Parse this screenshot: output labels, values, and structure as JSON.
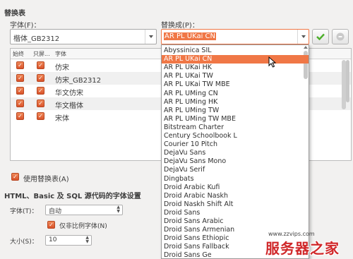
{
  "section_title": "替换表",
  "font_label": "字体(F)：",
  "font_value": "楷体_GB2312",
  "replace_label": "替换成(P)：",
  "replace_value": "AR PL UKai CN",
  "table": {
    "headers": [
      "始终",
      "只屏...",
      "字体"
    ],
    "rows": [
      {
        "font": "仿宋",
        "always": true,
        "screen_only": true
      },
      {
        "font": "仿宋_GB2312",
        "always": true,
        "screen_only": true
      },
      {
        "font": "华文仿宋",
        "always": true,
        "screen_only": true
      },
      {
        "font": "华文楷体",
        "always": true,
        "screen_only": true
      },
      {
        "font": "宋体",
        "always": true,
        "screen_only": true
      }
    ]
  },
  "use_table_label": "使用替换表(A)",
  "html_section_title": "HTML、Basic 及 SQL 源代码的字体设置",
  "src_font_label": "字体(T)：",
  "src_font_value": "自动",
  "proportional_label": "仅非比例字体(N)",
  "size_label": "大小(S)：",
  "size_value": "10",
  "dropdown_items": [
    "Abyssinica SIL",
    "AR PL UKai CN",
    "AR PL UKai HK",
    "AR PL UKai TW",
    "AR PL UKai TW MBE",
    "AR PL UMing CN",
    "AR PL UMing HK",
    "AR PL UMing TW",
    "AR PL UMing TW MBE",
    "Bitstream Charter",
    "Century Schoolbook L",
    "Courier 10 Pitch",
    "DejaVu Sans",
    "DejaVu Sans Mono",
    "DejaVu Serif",
    "Dingbats",
    "Droid Arabic Kufi",
    "Droid Arabic Naskh",
    "Droid Naskh Shift Alt",
    "Droid Sans",
    "Droid Sans Arabic",
    "Droid Sans Armenian",
    "Droid Sans Ethiopic",
    "Droid Sans Fallback",
    "Droid Sans Ge"
  ],
  "selected_item": "AR PL UKai CN",
  "watermark_url": "www.zzvips.com",
  "watermark_brand": "服务器之家",
  "accent_color": "#f07746",
  "apply_icon": "checkmark-icon",
  "delete_icon": "delete-icon"
}
